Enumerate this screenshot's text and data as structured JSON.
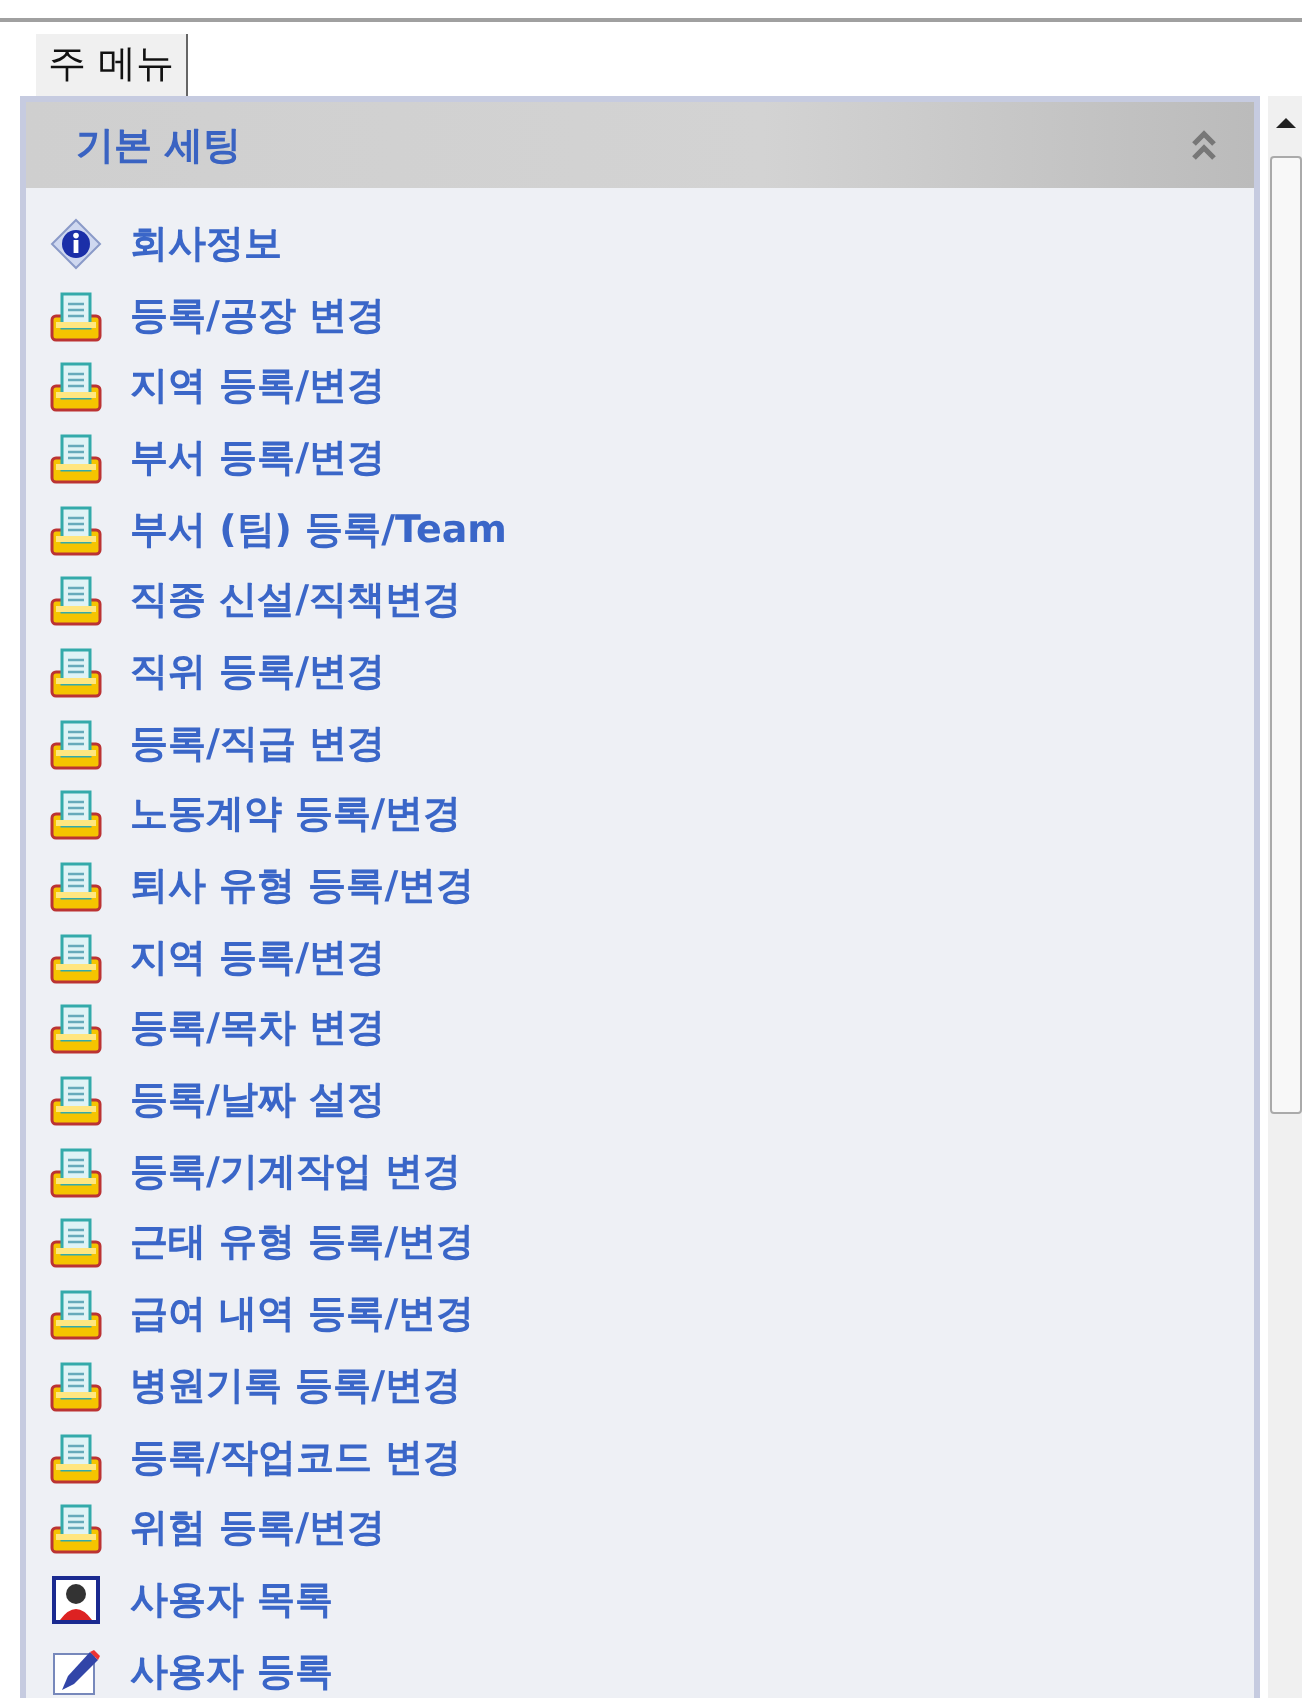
{
  "tabs": [
    {
      "label": "주 메뉴",
      "selected": true
    }
  ],
  "panel": {
    "title": "기본 세팅",
    "expanded": true,
    "items": [
      {
        "kind": "info",
        "label": "회사정보"
      },
      {
        "kind": "doc",
        "label": "등록/공장 변경"
      },
      {
        "kind": "doc",
        "label": "지역 등록/변경"
      },
      {
        "kind": "doc",
        "label": "부서 등록/변경"
      },
      {
        "kind": "doc",
        "label": "부서 (팀) 등록/Team"
      },
      {
        "kind": "doc",
        "label": "직종 신설/직책변경"
      },
      {
        "kind": "doc",
        "label": "직위 등록/변경"
      },
      {
        "kind": "doc",
        "label": "등록/직급 변경"
      },
      {
        "kind": "doc",
        "label": "노동계약 등록/변경"
      },
      {
        "kind": "doc",
        "label": "퇴사 유형 등록/변경"
      },
      {
        "kind": "doc",
        "label": "지역 등록/변경"
      },
      {
        "kind": "doc",
        "label": "등록/목차 변경"
      },
      {
        "kind": "doc",
        "label": "등록/날짜 설정"
      },
      {
        "kind": "doc",
        "label": "등록/기계작업 변경"
      },
      {
        "kind": "doc",
        "label": "근태 유형 등록/변경"
      },
      {
        "kind": "doc",
        "label": "급여 내역 등록/변경"
      },
      {
        "kind": "doc",
        "label": "병원기록 등록/변경"
      },
      {
        "kind": "doc",
        "label": "등록/작업코드 변경"
      },
      {
        "kind": "doc",
        "label": "위험 등록/변경"
      },
      {
        "kind": "user",
        "label": "사용자 목록"
      },
      {
        "kind": "edit",
        "label": "사용자 등록"
      }
    ]
  }
}
